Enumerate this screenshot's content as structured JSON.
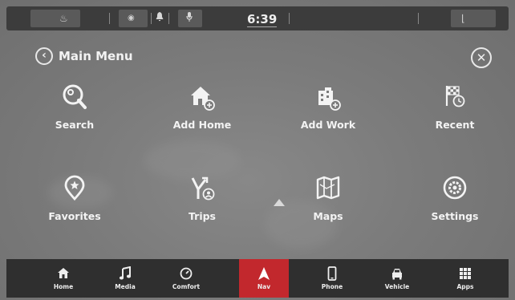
{
  "status_bar": {
    "clock": "6:39"
  },
  "header": {
    "title": "Main Menu",
    "back_icon": "chevron-left-circle-icon",
    "close_icon": "close-circle-icon"
  },
  "menu_items": [
    {
      "label": "Search",
      "icon": "search-icon"
    },
    {
      "label": "Add Home",
      "icon": "add-home-icon"
    },
    {
      "label": "Add Work",
      "icon": "add-work-icon"
    },
    {
      "label": "Recent",
      "icon": "recent-flag-icon"
    },
    {
      "label": "Favorites",
      "icon": "favorites-pin-icon"
    },
    {
      "label": "Trips",
      "icon": "trips-icon"
    },
    {
      "label": "Maps",
      "icon": "maps-icon"
    },
    {
      "label": "Settings",
      "icon": "settings-gear-icon"
    }
  ],
  "bottom_bar": {
    "active": "Nav",
    "active_color": "#c2282d",
    "items": [
      {
        "label": "Home",
        "icon": "home-icon"
      },
      {
        "label": "Media",
        "icon": "music-note-icon"
      },
      {
        "label": "Comfort",
        "icon": "comfort-dial-icon"
      },
      {
        "label": "Nav",
        "icon": "nav-arrow-icon"
      },
      {
        "label": "Phone",
        "icon": "phone-icon"
      },
      {
        "label": "Vehicle",
        "icon": "vehicle-icon"
      },
      {
        "label": "Apps",
        "icon": "apps-grid-icon"
      }
    ]
  }
}
